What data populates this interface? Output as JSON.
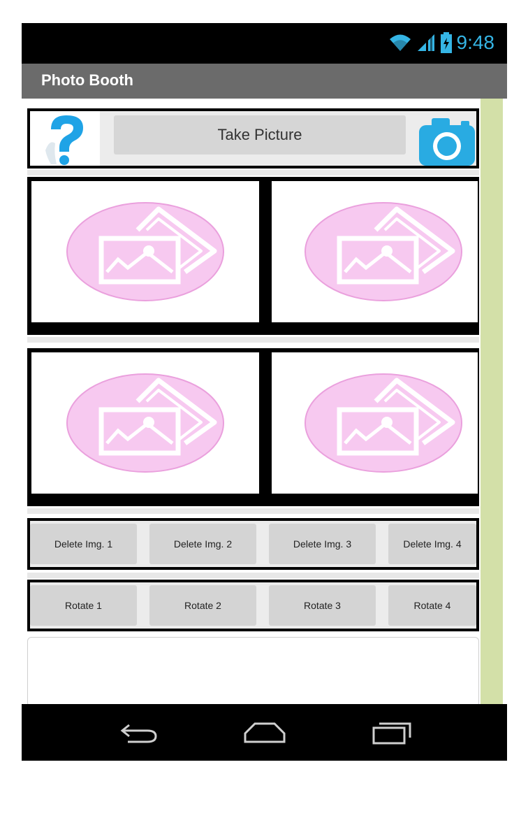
{
  "status": {
    "time": "9:48",
    "accent": "#35b5e5"
  },
  "app": {
    "title": "Photo Booth"
  },
  "toolbar": {
    "help_icon": "help-question-icon",
    "take_picture_label": "Take Picture",
    "camera_icon": "camera-icon"
  },
  "photos": [
    {
      "icon": "image-placeholder-icon"
    },
    {
      "icon": "image-placeholder-icon"
    },
    {
      "icon": "image-placeholder-icon"
    },
    {
      "icon": "image-placeholder-icon"
    }
  ],
  "delete_buttons": [
    "Delete Img. 1",
    "Delete Img. 2",
    "Delete Img. 3",
    "Delete Img. 4"
  ],
  "rotate_buttons": [
    "Rotate 1",
    "Rotate 2",
    "Rotate 3",
    "Rotate 4"
  ],
  "textbox": {
    "value": ""
  },
  "nav": {
    "back_icon": "back-icon",
    "home_icon": "home-icon",
    "recents_icon": "recents-icon"
  },
  "colors": {
    "placeholder_pink": "#f7c9f0",
    "scrollbar": "#d3e0a8",
    "titlebar": "#6b6b6b"
  }
}
